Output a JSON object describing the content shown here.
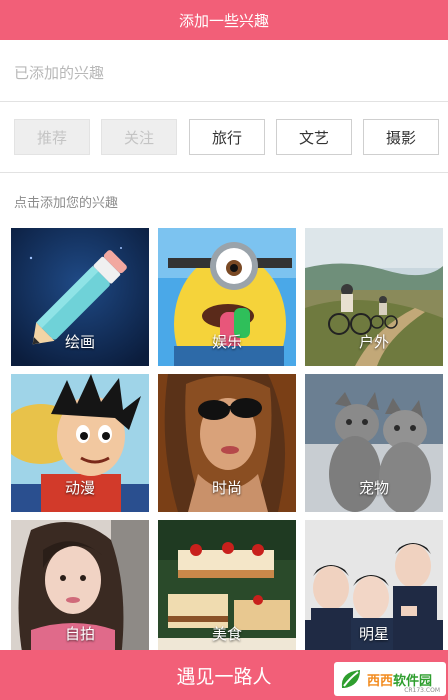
{
  "header": {
    "title": "添加一些兴趣"
  },
  "added": {
    "placeholder": "已添加的兴趣"
  },
  "tags": [
    {
      "label": "推荐",
      "state": "disabled"
    },
    {
      "label": "关注",
      "state": "disabled"
    },
    {
      "label": "旅行",
      "state": "active"
    },
    {
      "label": "文艺",
      "state": "active"
    },
    {
      "label": "摄影",
      "state": "active"
    }
  ],
  "section": {
    "label": "点击添加您的兴趣"
  },
  "interests": [
    {
      "label": "绘画",
      "icon": "pencil-art"
    },
    {
      "label": "娱乐",
      "icon": "minion-art"
    },
    {
      "label": "户外",
      "icon": "cyclists-art"
    },
    {
      "label": "动漫",
      "icon": "anime-art"
    },
    {
      "label": "时尚",
      "icon": "sunglasses-art"
    },
    {
      "label": "宠物",
      "icon": "kittens-art"
    },
    {
      "label": "自拍",
      "icon": "selfie-art"
    },
    {
      "label": "美食",
      "icon": "cake-art"
    },
    {
      "label": "明星",
      "icon": "stars-art"
    }
  ],
  "footer": {
    "button_label": "遇见一路人"
  },
  "watermark": {
    "brand_a": "西西",
    "brand_b": "软件园",
    "site": "CR173.COM"
  },
  "colors": {
    "accent": "#f25f78",
    "divider": "#e2e2e2"
  }
}
